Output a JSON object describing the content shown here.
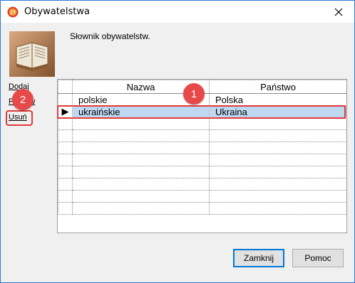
{
  "window": {
    "title": "Obywatelstwa",
    "description": "Słownik obywatelstw."
  },
  "side_links": {
    "add": "Dodaj",
    "edit": "Popraw",
    "delete": "Usuń"
  },
  "grid": {
    "columns": [
      "Nazwa",
      "Państwo"
    ],
    "rows": [
      {
        "name": "polskie",
        "country": "Polska"
      },
      {
        "name": "ukraińskie",
        "country": "Ukraina",
        "selected": true
      }
    ],
    "selected_marker": "▶"
  },
  "callouts": {
    "one": "1",
    "two": "2"
  },
  "buttons": {
    "close": "Zamknij",
    "help": "Pomoc"
  },
  "colors": {
    "highlight": "#e03a3a",
    "callout": "#e74848",
    "selection": "#bfd8f2"
  }
}
